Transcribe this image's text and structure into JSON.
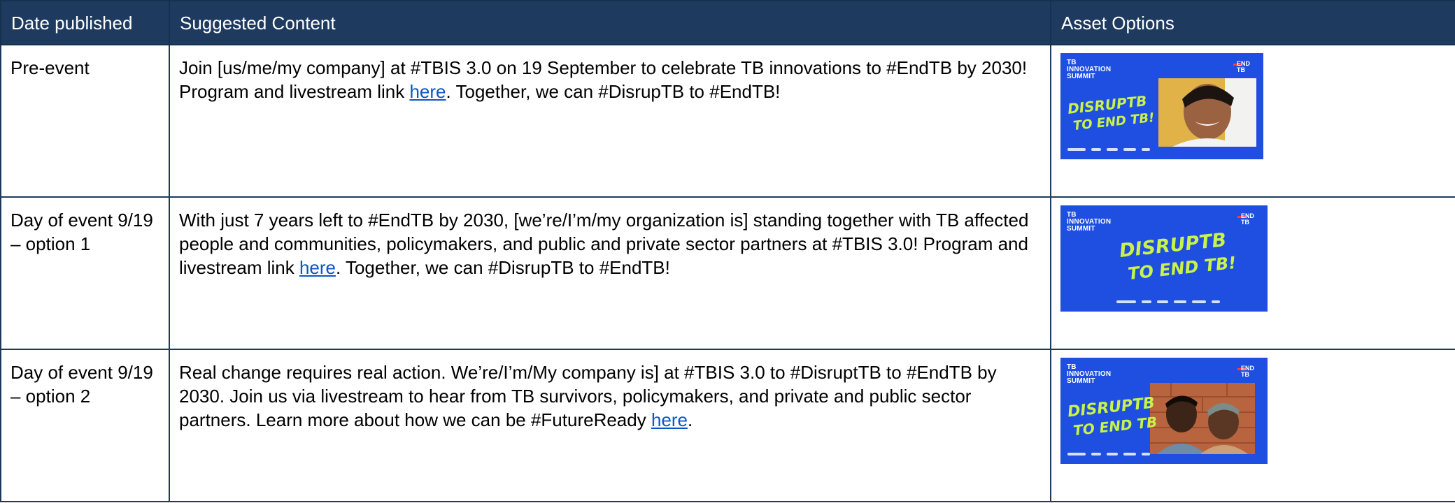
{
  "table": {
    "headers": [
      "Date published",
      "Suggested Content",
      "Asset Options"
    ],
    "rows": [
      {
        "date": "Pre-event",
        "content_before": "Join [us/me/my company] at #TBIS 3.0 on 19 September to celebrate TB innovations to #EndTB by 2030! Program and livestream link ",
        "link": "here",
        "content_after": ". Together, we can #DisrupTB to #EndTB!",
        "asset": {
          "summit": "TB INNOVATION SUMMIT",
          "end_tb": "END TB",
          "slogan_top": "DISRUPTB",
          "slogan_bottom": "TO END TB!"
        }
      },
      {
        "date": "Day of event 9/19 – option 1",
        "content_before": "With just 7 years left to #EndTB by 2030, [we’re/I’m/my organization is] standing together with TB affected people and communities, policymakers, and public and private sector partners at #TBIS 3.0! Program and livestream link ",
        "link": "here",
        "content_after": ". Together, we can #DisrupTB to #EndTB!",
        "asset": {
          "summit": "TB INNOVATION SUMMIT",
          "end_tb": "END TB",
          "slogan_top": "DISRUPTB",
          "slogan_bottom": "TO END TB!"
        }
      },
      {
        "date": "Day of event 9/19 – option 2",
        "content_before": "Real change requires real action. We’re/I’m/My company is] at #TBIS 3.0 to #DisruptTB to #EndTB by 2030. Join us via livestream to hear from TB survivors, policymakers, and private and public sector partners. Learn more about how we can be #FutureReady ",
        "link": "here",
        "content_after": ".",
        "asset": {
          "summit": "TB INNOVATION SUMMIT",
          "end_tb": "END TB",
          "slogan_top": "DISRUPTB",
          "slogan_bottom": "TO END TB"
        }
      }
    ]
  },
  "colors": {
    "header_bg": "#1e3a5f",
    "link": "#0b57c4",
    "asset_bg": "#1f4fe0",
    "slogan": "#c9f24a"
  }
}
